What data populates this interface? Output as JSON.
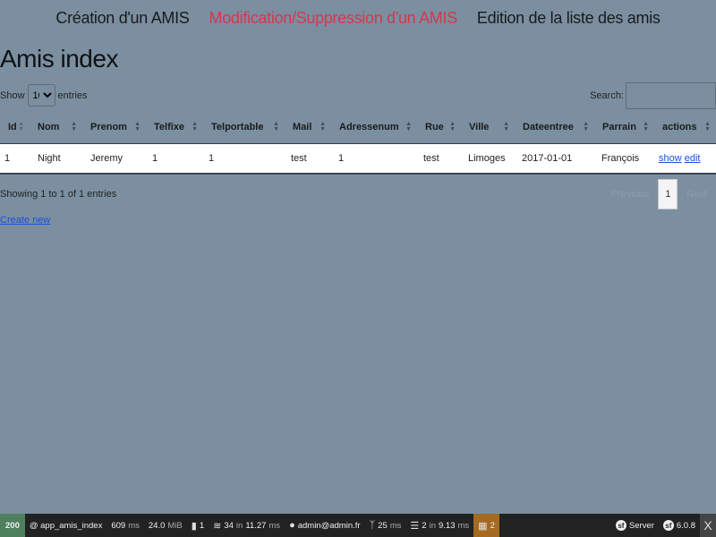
{
  "nav": {
    "create": "Création d'un AMIS",
    "modify": "Modification/Suppression d'un AMIS",
    "list": "Edition de la liste des amis"
  },
  "page": {
    "title": "Amis index"
  },
  "length_menu": {
    "prefix": "Show",
    "value": "10",
    "suffix": "entries"
  },
  "search": {
    "label": "Search:",
    "value": ""
  },
  "table": {
    "headers": [
      "Id",
      "Nom",
      "Prenom",
      "Telfixe",
      "Telportable",
      "Mail",
      "Adressenum",
      "Rue",
      "Ville",
      "Dateentree",
      "Parrain",
      "actions"
    ],
    "rows": [
      {
        "id": "1",
        "nom": "Night",
        "prenom": "Jeremy",
        "telfixe": "1",
        "telportable": "1",
        "mail": "test",
        "adressenum": "1",
        "rue": "test",
        "ville": "Limoges",
        "dateentree": "2017-01-01",
        "parrain": "François",
        "show": "show",
        "edit": "edit"
      }
    ]
  },
  "info": "Showing 1 to 1 of 1 entries",
  "pagination": {
    "previous": "Previous",
    "current": "1",
    "next": "Next"
  },
  "create_new": "Create new",
  "toolbar": {
    "status": "200",
    "route": "@ app_amis_index",
    "time_value": "609",
    "time_unit": "ms",
    "memory_value": "24.0",
    "memory_unit": "MiB",
    "logs": "1",
    "cache_calls": "34",
    "cache_in": "in",
    "cache_time": "11.27",
    "cache_unit": "ms",
    "user": "admin@admin.fr",
    "twig_time": "25",
    "twig_unit": "ms",
    "db_queries": "2",
    "db_in": "in",
    "db_time": "9.13",
    "db_unit": "ms",
    "forms": "2",
    "server": "Server",
    "symfony_version": "6.0.8",
    "close": "X"
  },
  "colors": {
    "background": "#7b8fa1",
    "active_nav": "#d4374e",
    "link": "#1a4fd8",
    "toolbar": "#222222",
    "status_ok": "#4f805d"
  }
}
